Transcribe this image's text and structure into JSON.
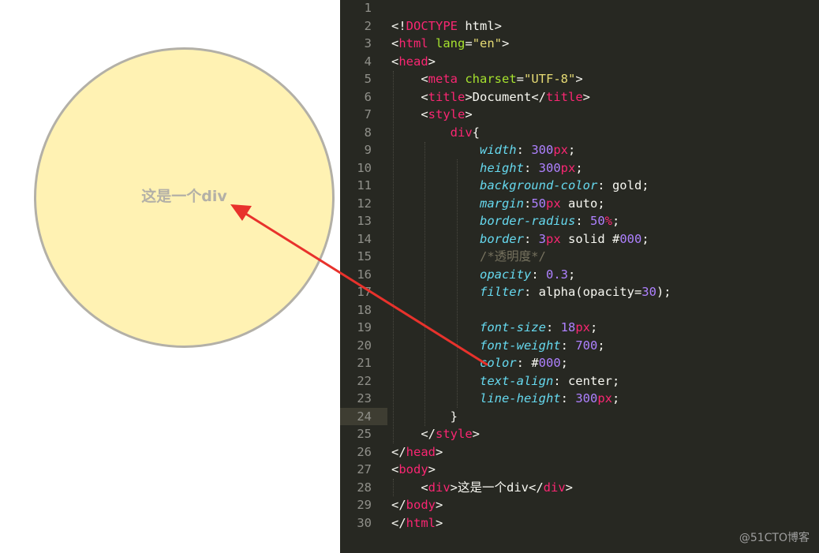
{
  "preview": {
    "text": "这是一个div"
  },
  "editor": {
    "lines": [
      {
        "n": "1",
        "tokens": []
      },
      {
        "n": "2",
        "tokens": [
          [
            "p",
            "<!"
          ],
          [
            "tag",
            "DOCTYPE"
          ],
          [
            "p",
            " html>"
          ]
        ]
      },
      {
        "n": "3",
        "tokens": [
          [
            "p",
            "<"
          ],
          [
            "tag",
            "html"
          ],
          [
            "p",
            " "
          ],
          [
            "attr",
            "lang"
          ],
          [
            "p",
            "="
          ],
          [
            "str",
            "\"en\""
          ],
          [
            "p",
            ">"
          ]
        ]
      },
      {
        "n": "4",
        "tokens": [
          [
            "p",
            "<"
          ],
          [
            "tag",
            "head"
          ],
          [
            "p",
            ">"
          ]
        ]
      },
      {
        "n": "5",
        "tokens": [
          [
            "p",
            "    <"
          ],
          [
            "tag",
            "meta"
          ],
          [
            "p",
            " "
          ],
          [
            "attr",
            "charset"
          ],
          [
            "p",
            "="
          ],
          [
            "str",
            "\"UTF-8\""
          ],
          [
            "p",
            ">"
          ]
        ]
      },
      {
        "n": "6",
        "tokens": [
          [
            "p",
            "    <"
          ],
          [
            "tag",
            "title"
          ],
          [
            "p",
            ">Document</"
          ],
          [
            "tag",
            "title"
          ],
          [
            "p",
            ">"
          ]
        ]
      },
      {
        "n": "7",
        "tokens": [
          [
            "p",
            "    <"
          ],
          [
            "tag",
            "style"
          ],
          [
            "p",
            ">"
          ]
        ]
      },
      {
        "n": "8",
        "tokens": [
          [
            "p",
            "        "
          ],
          [
            "tag",
            "div"
          ],
          [
            "p",
            "{"
          ]
        ]
      },
      {
        "n": "9",
        "tokens": [
          [
            "p",
            "            "
          ],
          [
            "prop",
            "width"
          ],
          [
            "p",
            ": "
          ],
          [
            "num",
            "300"
          ],
          [
            "unit",
            "px"
          ],
          [
            "p",
            ";"
          ]
        ]
      },
      {
        "n": "10",
        "tokens": [
          [
            "p",
            "            "
          ],
          [
            "prop",
            "height"
          ],
          [
            "p",
            ": "
          ],
          [
            "num",
            "300"
          ],
          [
            "unit",
            "px"
          ],
          [
            "p",
            ";"
          ]
        ]
      },
      {
        "n": "11",
        "tokens": [
          [
            "p",
            "            "
          ],
          [
            "prop",
            "background-color"
          ],
          [
            "p",
            ": gold;"
          ]
        ]
      },
      {
        "n": "12",
        "tokens": [
          [
            "p",
            "            "
          ],
          [
            "prop",
            "margin"
          ],
          [
            "p",
            ":"
          ],
          [
            "num",
            "50"
          ],
          [
            "unit",
            "px"
          ],
          [
            "p",
            " auto;"
          ]
        ]
      },
      {
        "n": "13",
        "tokens": [
          [
            "p",
            "            "
          ],
          [
            "prop",
            "border-radius"
          ],
          [
            "p",
            ": "
          ],
          [
            "num",
            "50"
          ],
          [
            "unit",
            "%"
          ],
          [
            "p",
            ";"
          ]
        ]
      },
      {
        "n": "14",
        "tokens": [
          [
            "p",
            "            "
          ],
          [
            "prop",
            "border"
          ],
          [
            "p",
            ": "
          ],
          [
            "num",
            "3"
          ],
          [
            "unit",
            "px"
          ],
          [
            "p",
            " solid #"
          ],
          [
            "num",
            "000"
          ],
          [
            "p",
            ";"
          ]
        ]
      },
      {
        "n": "15",
        "tokens": [
          [
            "p",
            "            "
          ],
          [
            "cmt",
            "/*透明度*/"
          ]
        ]
      },
      {
        "n": "16",
        "tokens": [
          [
            "p",
            "            "
          ],
          [
            "prop",
            "opacity"
          ],
          [
            "p",
            ": "
          ],
          [
            "num",
            "0.3"
          ],
          [
            "p",
            ";"
          ]
        ]
      },
      {
        "n": "17",
        "tokens": [
          [
            "p",
            "            "
          ],
          [
            "prop",
            "filter"
          ],
          [
            "p",
            ": alpha(opacity="
          ],
          [
            "num",
            "30"
          ],
          [
            "p",
            ");"
          ]
        ]
      },
      {
        "n": "18",
        "tokens": []
      },
      {
        "n": "19",
        "tokens": [
          [
            "p",
            "            "
          ],
          [
            "prop",
            "font-size"
          ],
          [
            "p",
            ": "
          ],
          [
            "num",
            "18"
          ],
          [
            "unit",
            "px"
          ],
          [
            "p",
            ";"
          ]
        ]
      },
      {
        "n": "20",
        "tokens": [
          [
            "p",
            "            "
          ],
          [
            "prop",
            "font-weight"
          ],
          [
            "p",
            ": "
          ],
          [
            "num",
            "700"
          ],
          [
            "p",
            ";"
          ]
        ]
      },
      {
        "n": "21",
        "tokens": [
          [
            "p",
            "            "
          ],
          [
            "prop",
            "color"
          ],
          [
            "p",
            ": #"
          ],
          [
            "num",
            "000"
          ],
          [
            "p",
            ";"
          ]
        ]
      },
      {
        "n": "22",
        "tokens": [
          [
            "p",
            "            "
          ],
          [
            "prop",
            "text-align"
          ],
          [
            "p",
            ": center;"
          ]
        ]
      },
      {
        "n": "23",
        "tokens": [
          [
            "p",
            "            "
          ],
          [
            "prop",
            "line-height"
          ],
          [
            "p",
            ": "
          ],
          [
            "num",
            "300"
          ],
          [
            "unit",
            "px"
          ],
          [
            "p",
            ";"
          ]
        ]
      },
      {
        "n": "24",
        "current": true,
        "tokens": [
          [
            "p",
            "        }"
          ]
        ]
      },
      {
        "n": "25",
        "tokens": [
          [
            "p",
            "    </"
          ],
          [
            "tag",
            "style"
          ],
          [
            "p",
            ">"
          ]
        ]
      },
      {
        "n": "26",
        "tokens": [
          [
            "p",
            "</"
          ],
          [
            "tag",
            "head"
          ],
          [
            "p",
            ">"
          ]
        ]
      },
      {
        "n": "27",
        "tokens": [
          [
            "p",
            "<"
          ],
          [
            "tag",
            "body"
          ],
          [
            "p",
            ">"
          ]
        ]
      },
      {
        "n": "28",
        "tokens": [
          [
            "p",
            "    <"
          ],
          [
            "tag",
            "div"
          ],
          [
            "p",
            ">这是一个div</"
          ],
          [
            "tag",
            "div"
          ],
          [
            "p",
            ">"
          ]
        ]
      },
      {
        "n": "29",
        "tokens": [
          [
            "p",
            "</"
          ],
          [
            "tag",
            "body"
          ],
          [
            "p",
            ">"
          ]
        ]
      },
      {
        "n": "30",
        "tokens": [
          [
            "p",
            "</"
          ],
          [
            "tag",
            "html"
          ],
          [
            "p",
            ">"
          ]
        ]
      }
    ]
  },
  "watermark": "@51CTO博客",
  "colors": {
    "editor_bg": "#272822",
    "circle_fill": "#fff2b3",
    "circle_border": "#b3b0a7",
    "arrow": "#e8322c"
  }
}
